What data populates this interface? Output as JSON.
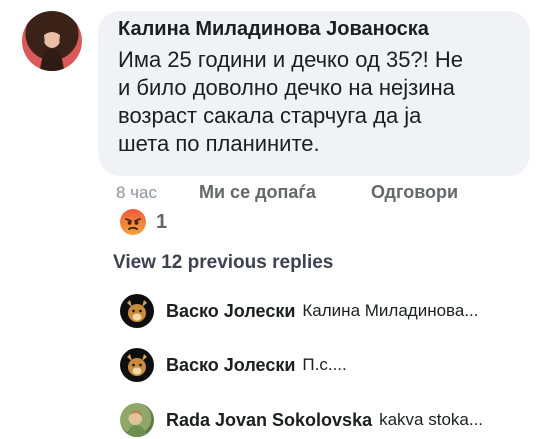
{
  "comment": {
    "author": "Калина Миладинова Јованоска",
    "text": "Има 25 години и дечко од 35?! Не\nи било доволно дечко на нејзина\nвозраст сакала старчуга да ја\nшета по планините.",
    "time": "8 час",
    "like_label": "Ми се допаѓа",
    "reply_label": "Одговори",
    "reaction": {
      "icon": "angry-reaction-icon",
      "count": "1"
    }
  },
  "view_replies_label": "View 12 previous replies",
  "replies": [
    {
      "name": "Васко Јолески",
      "text": "Калина Миладинова..."
    },
    {
      "name": "Васко Јолески",
      "text": "П.с...."
    },
    {
      "name": "Rada Jovan Sokolovska",
      "text": "kakva stoka..."
    }
  ],
  "colors": {
    "bubble": "#f0f2f5",
    "meta_gray": "#8d949e",
    "action_gray": "#65676b",
    "text": "#1c1e21"
  }
}
